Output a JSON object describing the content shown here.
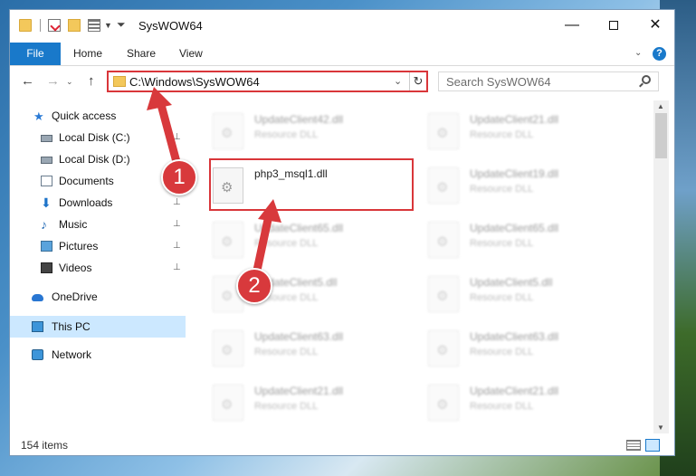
{
  "window": {
    "title": "SysWOW64",
    "minimize": "—",
    "close": "✕"
  },
  "ribbon": {
    "tabs": [
      "File",
      "Home",
      "Share",
      "View"
    ],
    "help": "?"
  },
  "nav": {
    "back": "←",
    "forward": "→",
    "recent": "⌄",
    "up": "↑"
  },
  "address": {
    "path": "C:\\Windows\\SysWOW64",
    "refresh": "↻"
  },
  "search": {
    "placeholder": "Search SysWOW64"
  },
  "sidebar": {
    "items": [
      {
        "label": "Quick access",
        "icon": "star-icon",
        "pinned": false
      },
      {
        "label": "Local Disk (C:)",
        "icon": "drive-icon",
        "pinned": true
      },
      {
        "label": "Local Disk (D:)",
        "icon": "drive-icon",
        "pinned": true
      },
      {
        "label": "Documents",
        "icon": "documents-icon",
        "pinned": true
      },
      {
        "label": "Downloads",
        "icon": "download-icon",
        "pinned": true
      },
      {
        "label": "Music",
        "icon": "music-icon",
        "pinned": true
      },
      {
        "label": "Pictures",
        "icon": "pictures-icon",
        "pinned": true
      },
      {
        "label": "Videos",
        "icon": "videos-icon",
        "pinned": true
      },
      {
        "label": "OneDrive",
        "icon": "cloud-icon",
        "pinned": false
      },
      {
        "label": "This PC",
        "icon": "pc-icon",
        "pinned": false,
        "selected": true
      },
      {
        "label": "Network",
        "icon": "network-icon",
        "pinned": false
      }
    ],
    "pin_glyph": "📌"
  },
  "files": {
    "left_column": [
      {
        "name": "UpdateClient42.dll",
        "type": "Resource DLL",
        "blurred": true
      },
      {
        "name": "php3_msql1.dll",
        "type": "",
        "blurred": false,
        "highlighted": true
      },
      {
        "name": "UpdateClient65.dll",
        "type": "Resource DLL",
        "blurred": true
      },
      {
        "name": "UpdateClient5.dll",
        "type": "Resource DLL",
        "blurred": true
      },
      {
        "name": "UpdateClient63.dll",
        "type": "Resource DLL",
        "blurred": true
      },
      {
        "name": "UpdateClient21.dll",
        "type": "Resource DLL",
        "blurred": true
      }
    ],
    "right_column": [
      {
        "name": "UpdateClient21.dll",
        "type": "Resource DLL",
        "blurred": true
      },
      {
        "name": "UpdateClient19.dll",
        "type": "Resource DLL",
        "blurred": true
      },
      {
        "name": "UpdateClient65.dll",
        "type": "Resource DLL",
        "blurred": true
      },
      {
        "name": "UpdateClient5.dll",
        "type": "Resource DLL",
        "blurred": true
      },
      {
        "name": "UpdateClient63.dll",
        "type": "Resource DLL",
        "blurred": true
      },
      {
        "name": "UpdateClient21.dll",
        "type": "Resource DLL",
        "blurred": true
      }
    ]
  },
  "status": {
    "item_count": "154 items"
  },
  "annotations": {
    "step1": "1",
    "step2": "2",
    "accent_color": "#d8393c"
  }
}
